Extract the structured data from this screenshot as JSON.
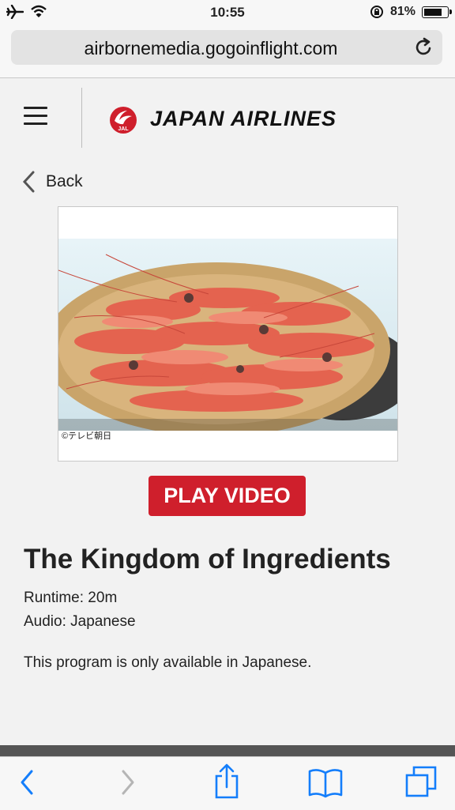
{
  "status": {
    "time": "10:55",
    "battery": "81%",
    "battery_level": 0.81,
    "icons": [
      "airplane-icon",
      "wifi-icon",
      "orientation-lock-icon",
      "battery-icon"
    ]
  },
  "browser": {
    "url": "airbornemedia.gogoinflight.com"
  },
  "header": {
    "brand": "JAPAN AIRLINES",
    "logo_text": "JAL",
    "brand_color": "#cf1f2c"
  },
  "nav": {
    "back_label": "Back"
  },
  "media": {
    "image_caption": "©テレビ朝日",
    "play_label": "PLAY VIDEO",
    "title": "The Kingdom of Ingredients",
    "runtime": "Runtime: 20m",
    "audio": "Audio: Japanese",
    "note": "This program is only available in Japanese."
  },
  "toolbar": {
    "items": [
      "back-icon",
      "forward-icon",
      "share-icon",
      "bookmarks-icon",
      "tabs-icon"
    ],
    "accent": "#147efb"
  }
}
